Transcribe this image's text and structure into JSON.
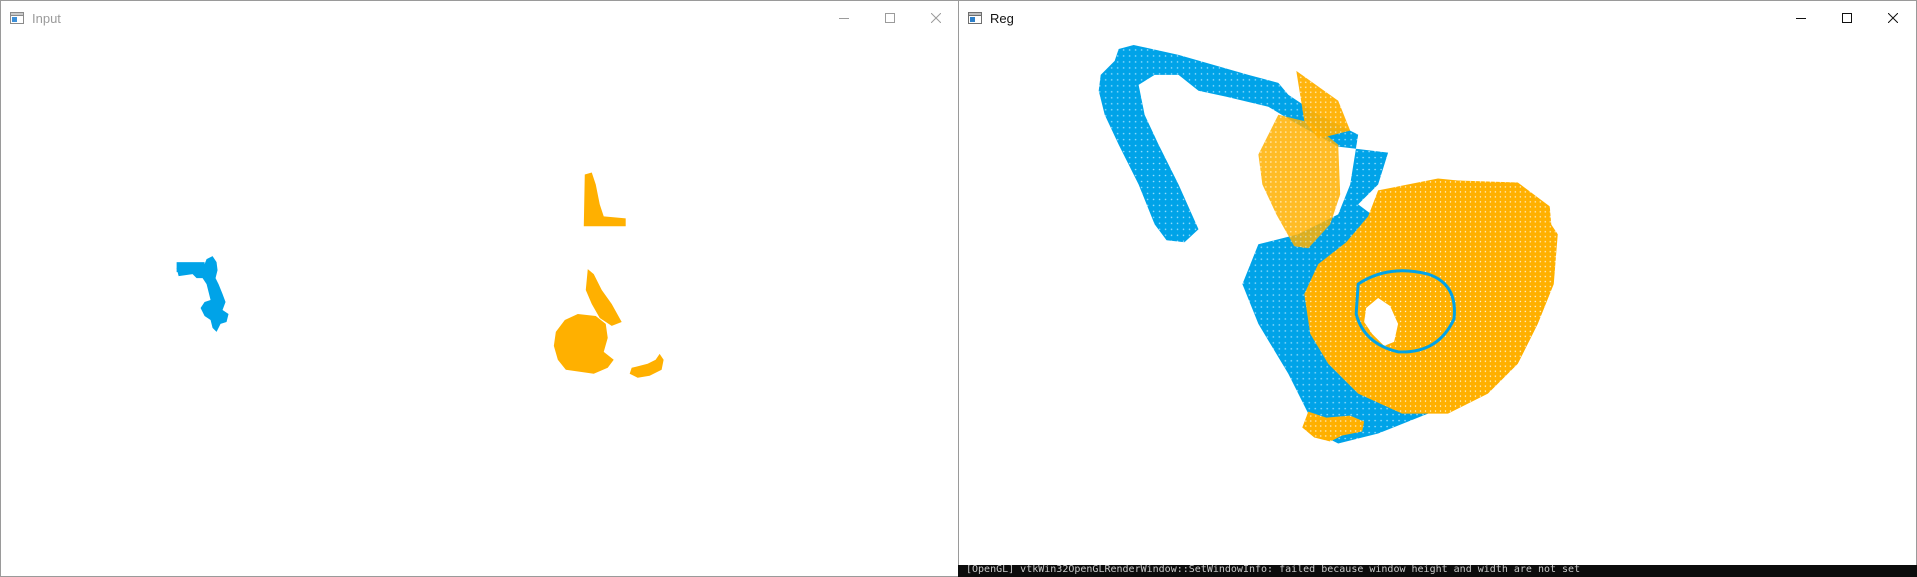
{
  "windows": {
    "input": {
      "title": "Input",
      "icon": "window-app-icon",
      "controls": [
        "minimize",
        "maximize",
        "close"
      ]
    },
    "reg": {
      "title": "Reg",
      "icon": "window-app-icon",
      "controls": [
        "minimize",
        "maximize",
        "close"
      ]
    }
  },
  "colors": {
    "source_cloud": "#00a3e8",
    "target_cloud": "#ffb000",
    "background": "#ffffff"
  },
  "console": {
    "text": "[OpenGL] vtkWin32OpenGLRenderWindow::SetWindowInfo: failed because window height and width are not set"
  }
}
